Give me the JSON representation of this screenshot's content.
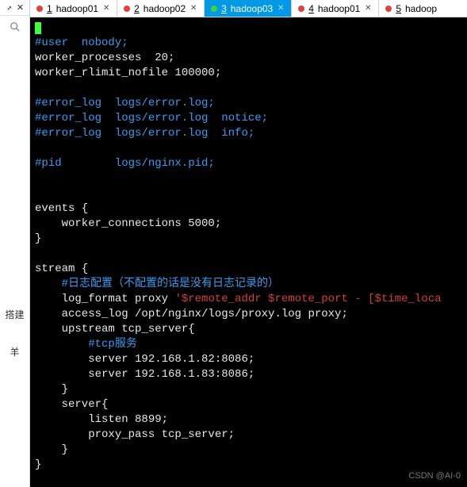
{
  "sidebar": {
    "label1": "搭建",
    "label2": "羊"
  },
  "tabs": [
    {
      "index": "1",
      "label": "hadoop01",
      "active": false
    },
    {
      "index": "2",
      "label": "hadoop02",
      "active": false
    },
    {
      "index": "3",
      "label": "hadoop03",
      "active": true
    },
    {
      "index": "4",
      "label": "hadoop01",
      "active": false
    },
    {
      "index": "5",
      "label": "hadoop",
      "active": false
    }
  ],
  "code": {
    "l1_comment": "#user  nobody;",
    "l2": "worker_processes  20;",
    "l3": "worker_rlimit_nofile 100000;",
    "l5_comment": "#error_log  logs/error.log;",
    "l6_comment": "#error_log  logs/error.log  notice;",
    "l7_comment": "#error_log  logs/error.log  info;",
    "l9_comment": "#pid        logs/nginx.pid;",
    "l12": "events {",
    "l13": "    worker_connections 5000;",
    "l14": "}",
    "l16": "stream {",
    "l17_comment": "    #日志配置（不配置的话是没有日志记录的）",
    "l18a": "    log_format proxy ",
    "l18b": "'$remote_addr $remote_port - [$time_loca",
    "l19": "    access_log /opt/nginx/logs/proxy.log proxy;",
    "l20": "    upstream tcp_server{",
    "l21_comment": "        #tcp服务",
    "l22": "        server 192.168.1.82:8086;",
    "l23": "        server 192.168.1.83:8086;",
    "l24": "    }",
    "l25": "    server{",
    "l26": "        listen 8899;",
    "l27": "        proxy_pass tcp_server;",
    "l28": "    }",
    "l29": "}"
  },
  "watermark": "CSDN @AI-0"
}
